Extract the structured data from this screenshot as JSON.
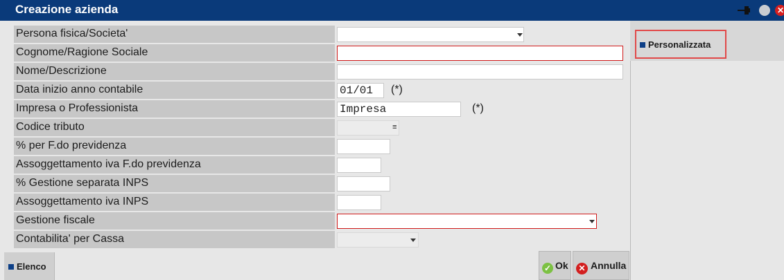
{
  "window": {
    "title": "Creazione azienda",
    "controls": {
      "pin": "pin-icon",
      "restore": "circle-icon",
      "close": "close-icon",
      "close_glyph": "✕"
    }
  },
  "form": {
    "fields": [
      {
        "label": "Persona fisica/Societa'",
        "value": "",
        "type": "select"
      },
      {
        "label": "Cognome/Ragione Sociale",
        "value": "",
        "type": "text",
        "required": true
      },
      {
        "label": "Nome/Descrizione",
        "value": "",
        "type": "text"
      },
      {
        "label": "Data inizio anno contabile",
        "value": "01/01",
        "suffix": "(*)"
      },
      {
        "label": "Impresa o Professionista",
        "value": "Impresa",
        "suffix": "(*)"
      },
      {
        "label": "Codice tributo",
        "value": "",
        "type": "lookup",
        "icon_glyph": "≡"
      },
      {
        "label": "% per F.do previdenza",
        "value": ""
      },
      {
        "label": "Assoggettamento iva F.do previdenza",
        "value": ""
      },
      {
        "label": "% Gestione separata INPS",
        "value": ""
      },
      {
        "label": "Assoggettamento iva INPS",
        "value": ""
      },
      {
        "label": "Gestione fiscale",
        "value": "",
        "type": "select",
        "required": true
      },
      {
        "label": "Contabilita' per Cassa",
        "value": "",
        "type": "select"
      }
    ]
  },
  "side": {
    "custom_button": "Personalizzata"
  },
  "footer": {
    "elenco": "Elenco",
    "ok": "Ok",
    "ok_glyph": "✓",
    "annulla": "Annulla",
    "annulla_glyph": "✕"
  },
  "colors": {
    "titlebar": "#0a3a7a",
    "label_bg": "#c7c7c7",
    "required_border": "#d01818",
    "highlight_border": "#e14848"
  }
}
